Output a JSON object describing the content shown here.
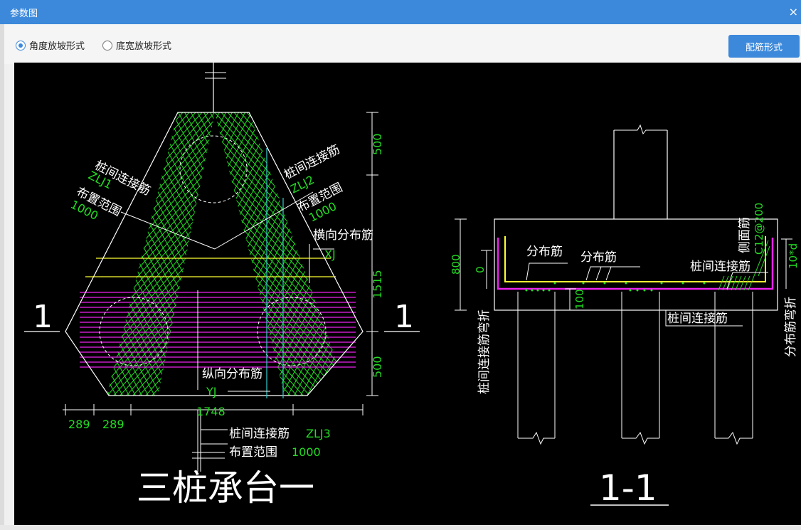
{
  "window": {
    "title": "参数图",
    "close": "×"
  },
  "options": {
    "radio_angle": "角度放坡形式",
    "radio_width": "底宽放坡形式",
    "selected": "angle",
    "rebar_button": "配筋形式"
  },
  "plan": {
    "label_zlj1_title": "桩间连接筋",
    "label_zlj1_code": "ZLJ1",
    "label_zlj1_range": "布置范围",
    "label_zlj1_value": "1000",
    "label_zlj2_title": "桩间连接筋",
    "label_zlj2_code": "ZLJ2",
    "label_zlj2_range": "布置范围",
    "label_zlj2_value": "1000",
    "transverse": "横向分布筋",
    "xj": "XJ",
    "longitudinal": "纵向分布筋",
    "yj": "YJ",
    "zlj3_title": "桩间连接筋",
    "zlj3_code": "ZLJ3",
    "zlj3_range": "布置范围",
    "zlj3_value": "1000",
    "dim_500_top": "500",
    "dim_1515": "1515",
    "dim_500_bottom": "500",
    "dim_289_a": "289",
    "dim_289_b": "289",
    "dim_1748": "1748",
    "section_mark": "1",
    "caption": "三桩承台一"
  },
  "section": {
    "dist1": "分布筋",
    "dist2": "分布筋",
    "side": "侧面筋",
    "side_code": "C12@200",
    "conn_right": "桩间连接筋",
    "conn_bottom": "桩间连接筋",
    "dim_800": "800",
    "dim_0": "0",
    "dim_100": "100",
    "left_vertical": "桩间连接筋弯折",
    "right_vertical": "分布筋弯折",
    "right_dim": "10*d",
    "caption": "1-1"
  },
  "colors": {
    "titlebar": "#3c89db",
    "green": "#22dd22",
    "yellow": "#ffff33",
    "magenta": "#ee22ee",
    "cyan": "#33cccc",
    "white": "#ffffff"
  }
}
